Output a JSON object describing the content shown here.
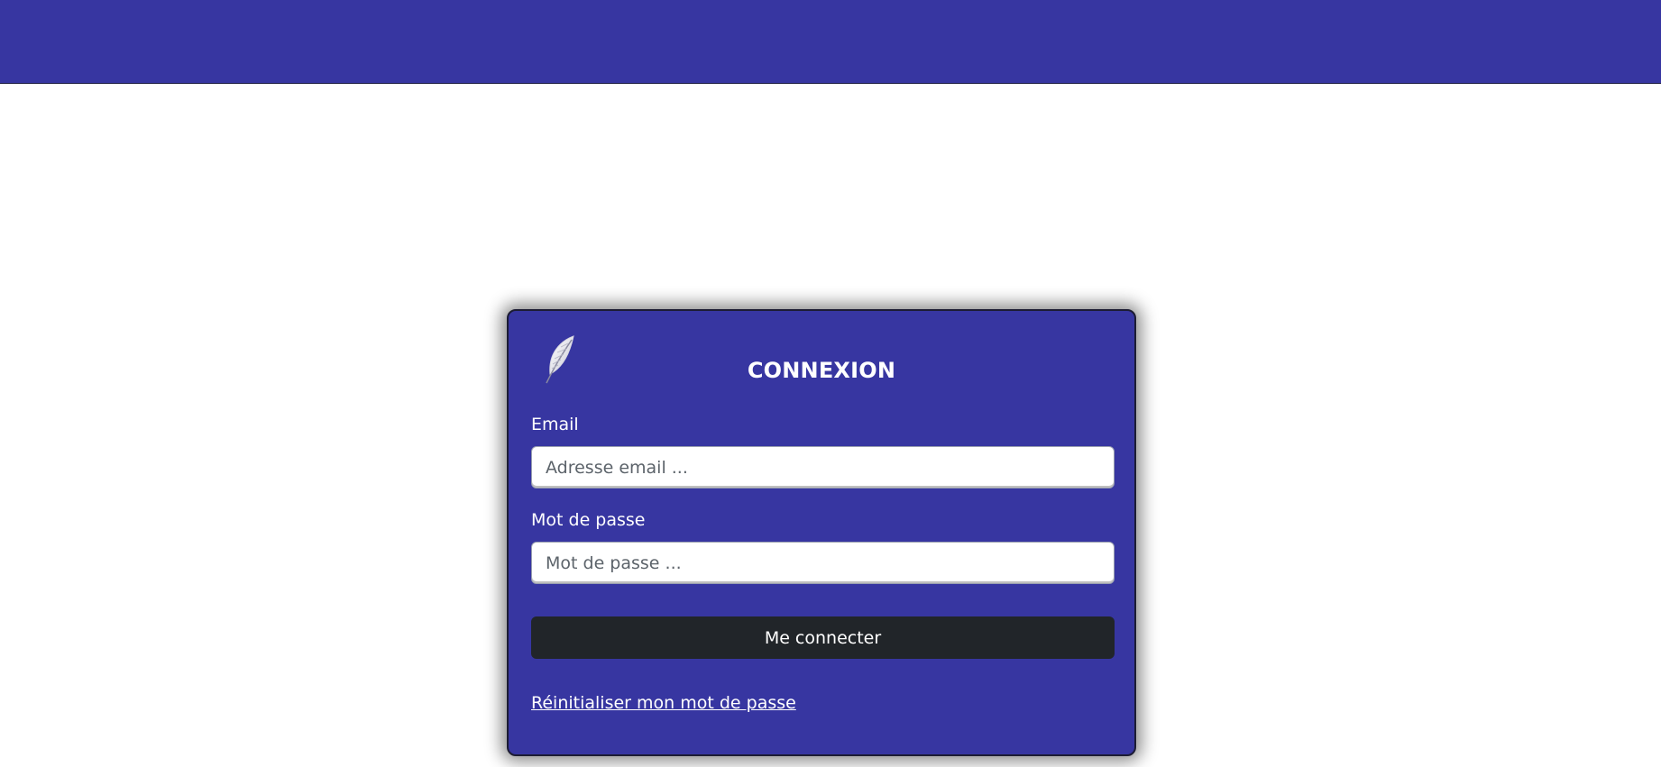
{
  "colors": {
    "brand": "#3736a1",
    "button": "#212529",
    "text_light": "#ffffff"
  },
  "login": {
    "logo_icon": "feather-icon",
    "title": "CONNEXION",
    "email_label": "Email",
    "email_placeholder": "Adresse email ...",
    "email_value": "",
    "password_label": "Mot de passe",
    "password_placeholder": "Mot de passe ...",
    "password_value": "",
    "submit_label": "Me connecter",
    "reset_link": "Réinitialiser mon mot de passe"
  }
}
